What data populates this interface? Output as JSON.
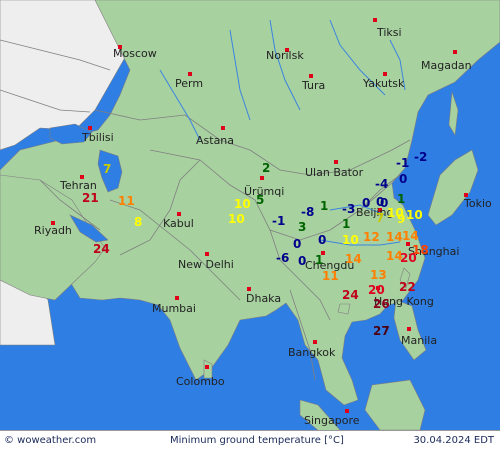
{
  "map": {
    "colors": {
      "sea": "#2f7ee3",
      "land": "#a8d1a0",
      "outer_land": "#eeeeee",
      "border": "#7f7f7f",
      "river": "#3b84de",
      "city_marker": "#e0001a"
    },
    "cities": [
      {
        "name": "Moscow"
      },
      {
        "name": "Norilsk"
      },
      {
        "name": "Tiksi"
      },
      {
        "name": "Magadan"
      },
      {
        "name": "Perm"
      },
      {
        "name": "Tura"
      },
      {
        "name": "Yakutsk"
      },
      {
        "name": "Tbilisi"
      },
      {
        "name": "Astana"
      },
      {
        "name": "Ulan Bator"
      },
      {
        "name": "Tehran"
      },
      {
        "name": "Ürümqi"
      },
      {
        "name": "Tokio"
      },
      {
        "name": "Riyadh"
      },
      {
        "name": "Kabul"
      },
      {
        "name": "Beijing"
      },
      {
        "name": "New Delhi"
      },
      {
        "name": "Chengdu"
      },
      {
        "name": "Shanghai"
      },
      {
        "name": "Mumbai"
      },
      {
        "name": "Dhaka"
      },
      {
        "name": "Hong Kong"
      },
      {
        "name": "Manila"
      },
      {
        "name": "Bangkok"
      },
      {
        "name": "Colombo"
      },
      {
        "name": "Singapore"
      }
    ],
    "temperatures": [
      {
        "value": "7",
        "color": "#c9c900"
      },
      {
        "value": "21",
        "color": "#c0001a"
      },
      {
        "value": "11",
        "color": "#ff7f00"
      },
      {
        "value": "8",
        "color": "#ffff00"
      },
      {
        "value": "24",
        "color": "#c0001a"
      },
      {
        "value": "2",
        "color": "#006400"
      },
      {
        "value": "10",
        "color": "#ffff00"
      },
      {
        "value": "5",
        "color": "#006400"
      },
      {
        "value": "10",
        "color": "#ffff00"
      },
      {
        "value": "-1",
        "color": "#00008b"
      },
      {
        "value": "-8",
        "color": "#00008b"
      },
      {
        "value": "1",
        "color": "#006400"
      },
      {
        "value": "-3",
        "color": "#00008b"
      },
      {
        "value": "3",
        "color": "#006400"
      },
      {
        "value": "0",
        "color": "#00008b"
      },
      {
        "value": "1",
        "color": "#006400"
      },
      {
        "value": "0",
        "color": "#00008b"
      },
      {
        "value": "-6",
        "color": "#00008b"
      },
      {
        "value": "0",
        "color": "#00008b"
      },
      {
        "value": "1",
        "color": "#006400"
      },
      {
        "value": "10",
        "color": "#ffff00"
      },
      {
        "value": "14",
        "color": "#ff7f00"
      },
      {
        "value": "11",
        "color": "#ff7f00"
      },
      {
        "value": "-1",
        "color": "#00008b"
      },
      {
        "value": "-2",
        "color": "#00008b"
      },
      {
        "value": "0",
        "color": "#00008b"
      },
      {
        "value": "-4",
        "color": "#00008b"
      },
      {
        "value": "1",
        "color": "#006400"
      },
      {
        "value": "0",
        "color": "#00008b"
      },
      {
        "value": "0",
        "color": "#00008b"
      },
      {
        "value": "7",
        "color": "#c9c900"
      },
      {
        "value": "10",
        "color": "#ffff00"
      },
      {
        "value": "12",
        "color": "#ff7f00"
      },
      {
        "value": "14",
        "color": "#ff7f00"
      },
      {
        "value": "9",
        "color": "#ffff00"
      },
      {
        "value": "14",
        "color": "#ff7f00"
      },
      {
        "value": "14",
        "color": "#ff7f00"
      },
      {
        "value": "18",
        "color": "#ff4000"
      },
      {
        "value": "13",
        "color": "#ff7f00"
      },
      {
        "value": "20",
        "color": "#e00020"
      },
      {
        "value": "20",
        "color": "#e00020"
      },
      {
        "value": "22",
        "color": "#c0001a"
      },
      {
        "value": "24",
        "color": "#c0001a"
      },
      {
        "value": "26",
        "color": "#8b0020"
      },
      {
        "value": "27",
        "color": "#4a0012"
      },
      {
        "value": "10",
        "color": "#ffff00"
      },
      {
        "value": "0",
        "color": "#00008b"
      }
    ]
  },
  "footer": {
    "source": "© woweather.com",
    "title": "Minimum ground temperature [°C]",
    "date": "30.04.2024 EDT"
  }
}
